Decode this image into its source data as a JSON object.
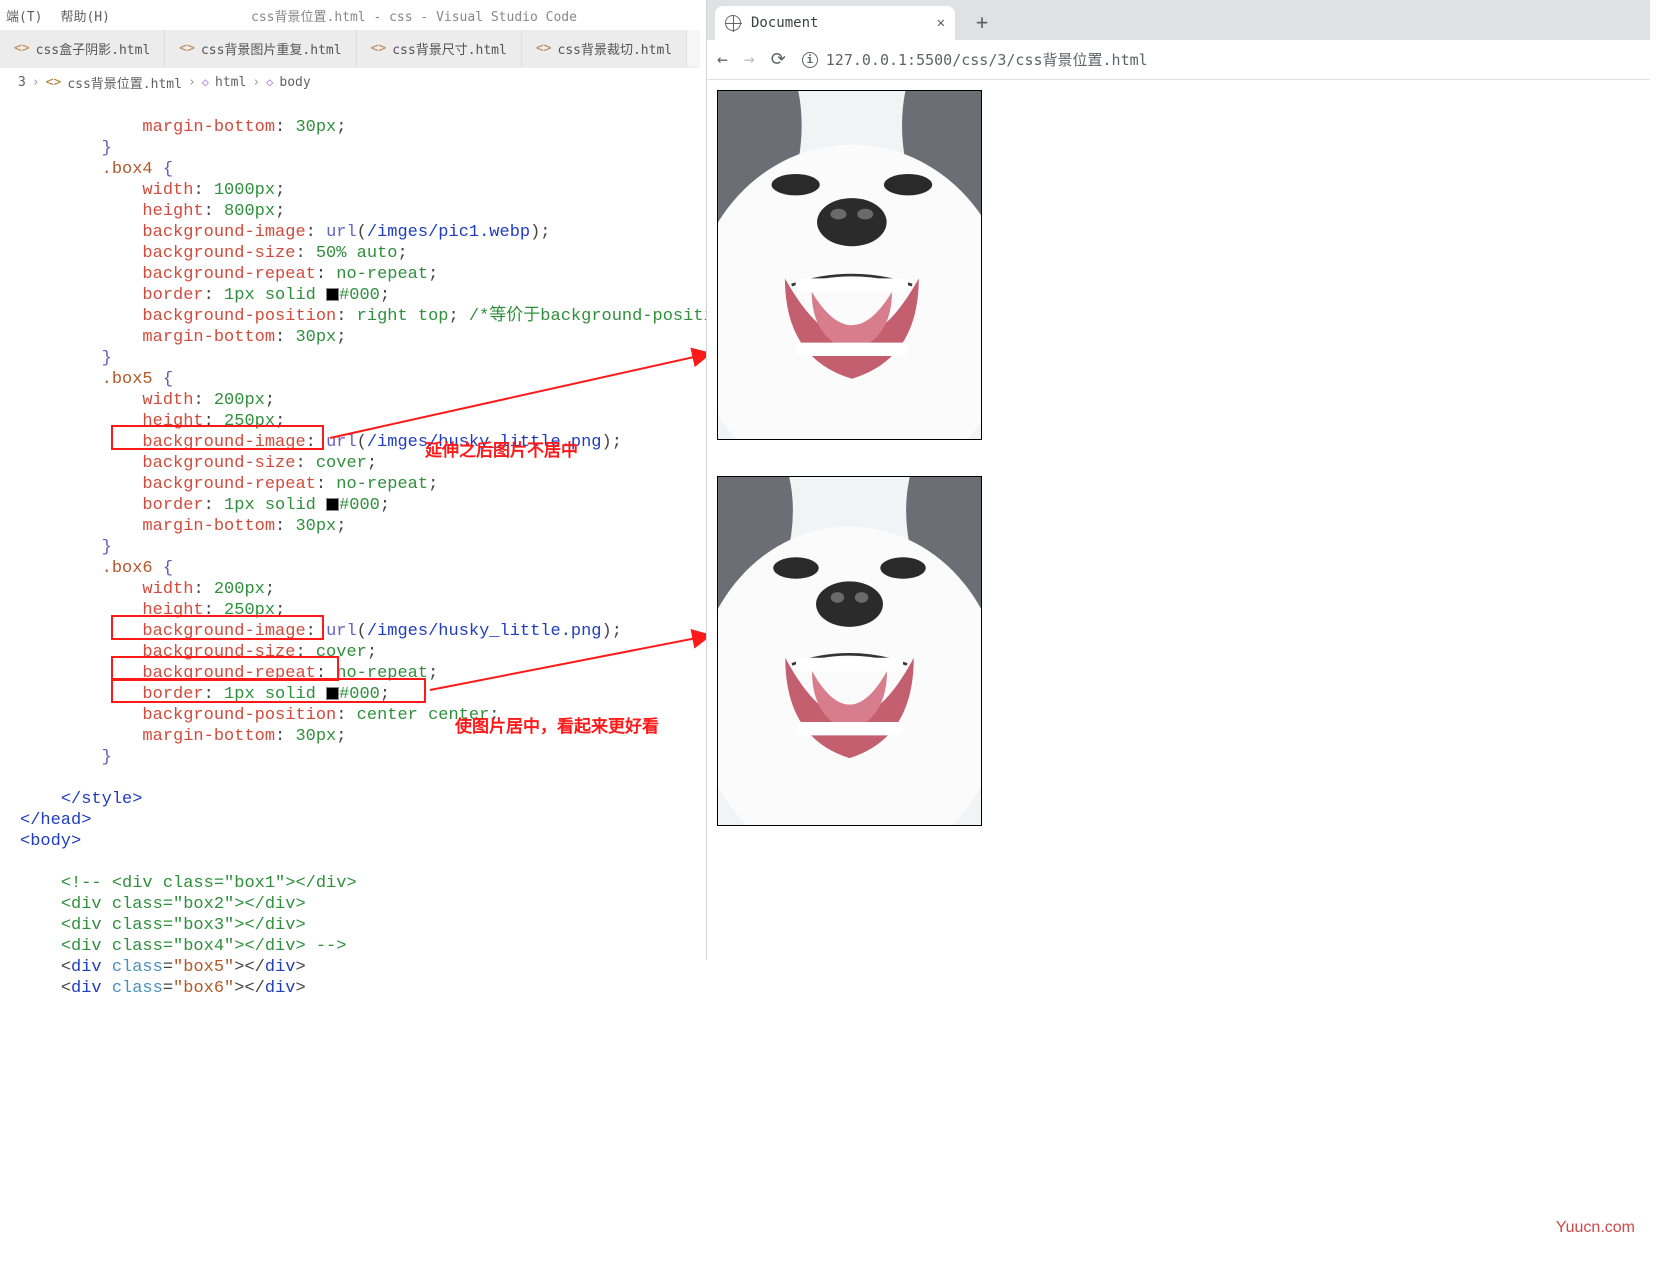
{
  "vscode": {
    "menus": [
      "端(T)",
      "帮助(H)"
    ],
    "window_title": "css背景位置.html - css - Visual Studio Code",
    "tabs": [
      "css盒子阴影.html",
      "css背景图片重复.html",
      "css背景尺寸.html",
      "css背景裁切.html"
    ],
    "breadcrumb": {
      "lead": "3",
      "file": "css背景位置.html",
      "html": "html",
      "body": "body"
    },
    "code": {
      "l1": "margin-bottom",
      "l1v": "30px",
      "sel4": ".box4",
      "w4": "1000px",
      "h4": "800px",
      "bgimg4": "/imges/pic1.webp",
      "bgsize4": "50% auto",
      "bgrep4": "no-repeat",
      "border4a": "1px",
      "border4b": "solid",
      "border4c": "#000",
      "bgpos4": "right top",
      "cmt4": "/*等价于background-position: top rig",
      "mb4": "30px",
      "sel5": ".box5",
      "w5": "200px",
      "h5": "250px",
      "bgimg5": "/imges/husky_little.png",
      "bgsize5": "cover",
      "bgrep5": "no-repeat",
      "border5a": "1px",
      "border5b": "solid",
      "border5c": "#000",
      "mb5": "30px",
      "sel6": ".box6",
      "w6": "200px",
      "h6": "250px",
      "bgimg6": "/imges/husky_little.png",
      "bgsize6": "cover",
      "bgrep6": "no-repeat",
      "border6a": "1px",
      "border6b": "solid",
      "border6c": "#000",
      "bgpos6": "center center",
      "mb6": "30px",
      "style_close": "</style>",
      "head_close": "</head>",
      "body_open": "<body>",
      "c1": "<!-- <div class=\"box1\"></div>",
      "c2": "<div class=\"box2\"></div>",
      "c3": "<div class=\"box3\"></div>",
      "c4": "<div class=\"box4\"></div> -->",
      "r5a": "div",
      "r5cls": "class",
      "r5val": "\"box5\"",
      "r6a": "div",
      "r6cls": "class",
      "r6val": "\"box6\""
    }
  },
  "annotations": {
    "a1": "延伸之后图片不居中",
    "a2": "使图片居中，看起来更好看"
  },
  "browser": {
    "tab_title": "Document",
    "url": "127.0.0.1:5500/css/3/css背景位置.html"
  },
  "watermark": "Yuucn.com"
}
